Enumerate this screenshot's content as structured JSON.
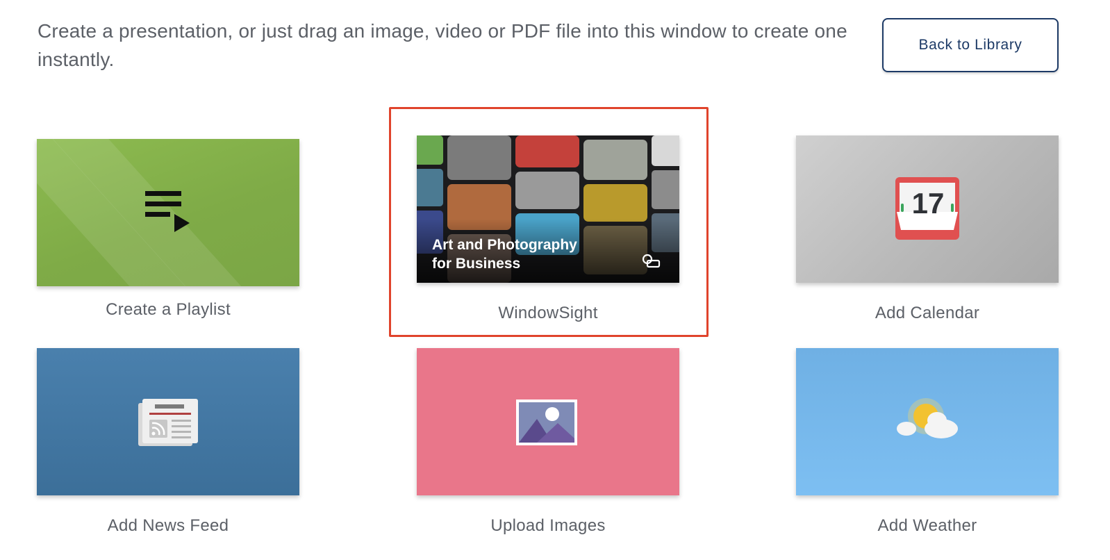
{
  "header": {
    "intro_text": "Create a presentation, or just drag an image, video or PDF file into this window to create one instantly.",
    "back_button_label": "Back to Library"
  },
  "tiles": [
    {
      "label": "Create a Playlist",
      "icon": "playlist-icon",
      "color": "#86b24c"
    },
    {
      "label": "WindowSight",
      "icon": "windowsight-app-icon",
      "thumb_title_line1": "Art and Photography",
      "thumb_title_line2": "for Business",
      "selected": true
    },
    {
      "label": "Add Calendar",
      "icon": "calendar-icon",
      "calendar_day": "17",
      "color": "#bdbdbd"
    },
    {
      "label": "Add News Feed",
      "icon": "news-feed-icon",
      "color": "#4277a3"
    },
    {
      "label": "Upload Images",
      "icon": "image-icon",
      "color": "#e9768a"
    },
    {
      "label": "Add Weather",
      "icon": "weather-icon",
      "color": "#76b8ec"
    }
  ],
  "colors": {
    "accent_navy": "#1d3a66",
    "selection_red": "#e0442c"
  }
}
